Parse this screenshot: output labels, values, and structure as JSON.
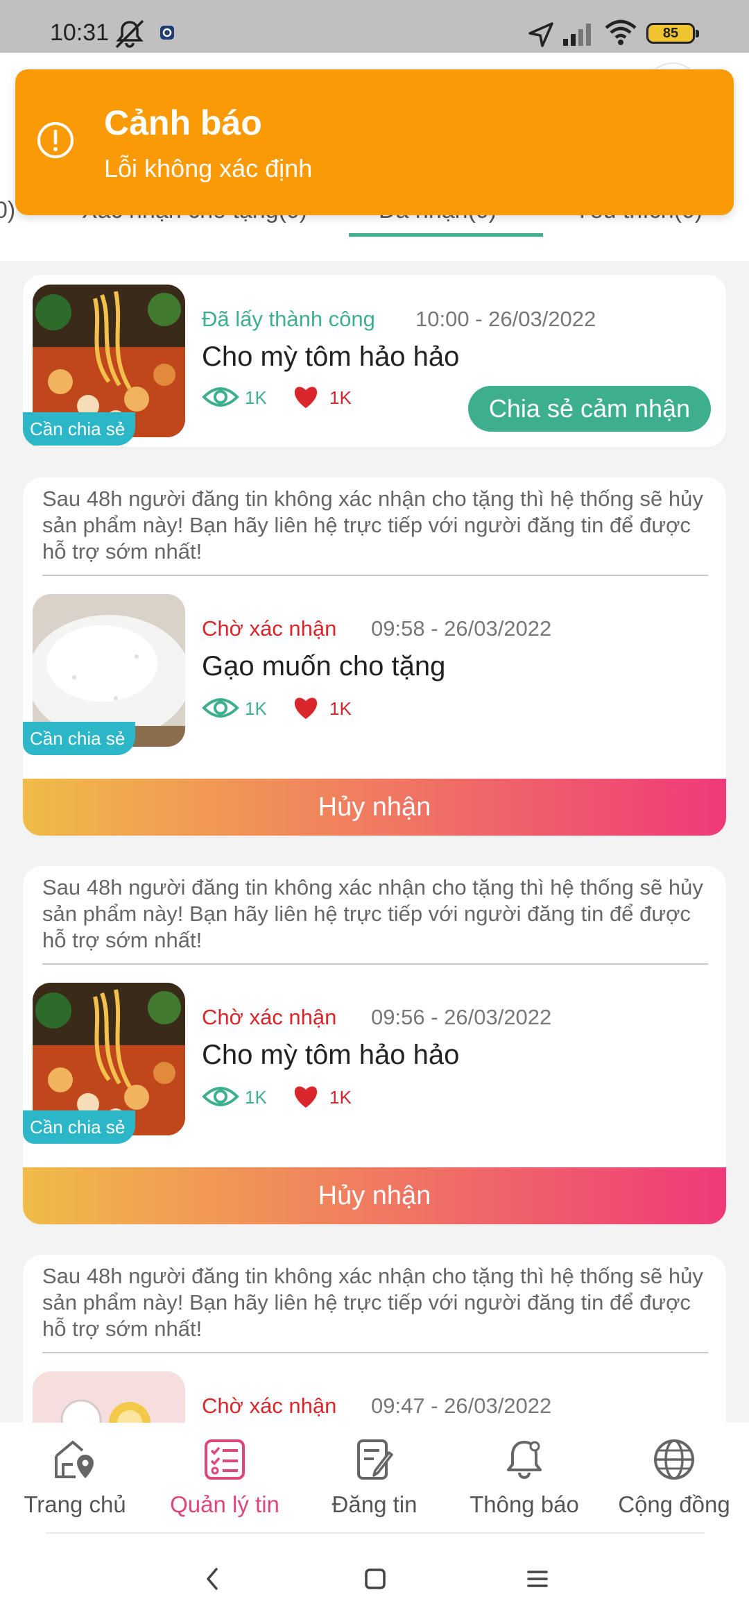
{
  "status_bar": {
    "time": "10:31",
    "battery": "85"
  },
  "toast": {
    "title": "Cảnh báo",
    "message": "Lỗi không xác định"
  },
  "tabs": [
    {
      "label": "0)"
    },
    {
      "label": "Xác nhận cho tặng(0)"
    },
    {
      "label": "Đã nhận(0)"
    },
    {
      "label": "Yêu thích(0)"
    }
  ],
  "notice_text": "Sau 48h người đăng tin không xác nhận cho tặng thì hệ thống sẽ hủy sản phẩm này! Bạn hãy liên hệ trực tiếp với người đăng tin để được hỗ trợ sớm nhất!",
  "posts": [
    {
      "status": "Đã lấy thành công",
      "date": "10:00 - 26/03/2022",
      "title": "Cho mỳ tôm hảo hảo",
      "views": "1K",
      "likes": "1K",
      "tag": "Cần chia sẻ",
      "action": "Chia sẻ cảm nhận"
    },
    {
      "status": "Chờ xác nhận",
      "date": "09:58 - 26/03/2022",
      "title": "Gạo muốn cho tặng",
      "views": "1K",
      "likes": "1K",
      "tag": "Cần chia sẻ",
      "action": "Hủy nhận"
    },
    {
      "status": "Chờ xác nhận",
      "date": "09:56 - 26/03/2022",
      "title": "Cho mỳ tôm hảo hảo",
      "views": "1K",
      "likes": "1K",
      "tag": "Cần chia sẻ",
      "action": "Hủy nhận"
    },
    {
      "status": "Chờ xác nhận",
      "date": "09:47 - 26/03/2022"
    }
  ],
  "bottom_nav": [
    {
      "label": "Trang chủ",
      "icon": "home-location-icon"
    },
    {
      "label": "Quản lý tin",
      "icon": "checklist-icon",
      "active": true
    },
    {
      "label": "Đăng tin",
      "icon": "post-edit-icon"
    },
    {
      "label": "Thông báo",
      "icon": "bell-icon"
    },
    {
      "label": "Cộng đồng",
      "icon": "globe-icon"
    }
  ],
  "colors": {
    "accent": "#3daf8f",
    "warning": "#fa9a06",
    "pending": "#d9262c",
    "active_nav": "#e0457b",
    "tag": "#2cb7c9"
  }
}
